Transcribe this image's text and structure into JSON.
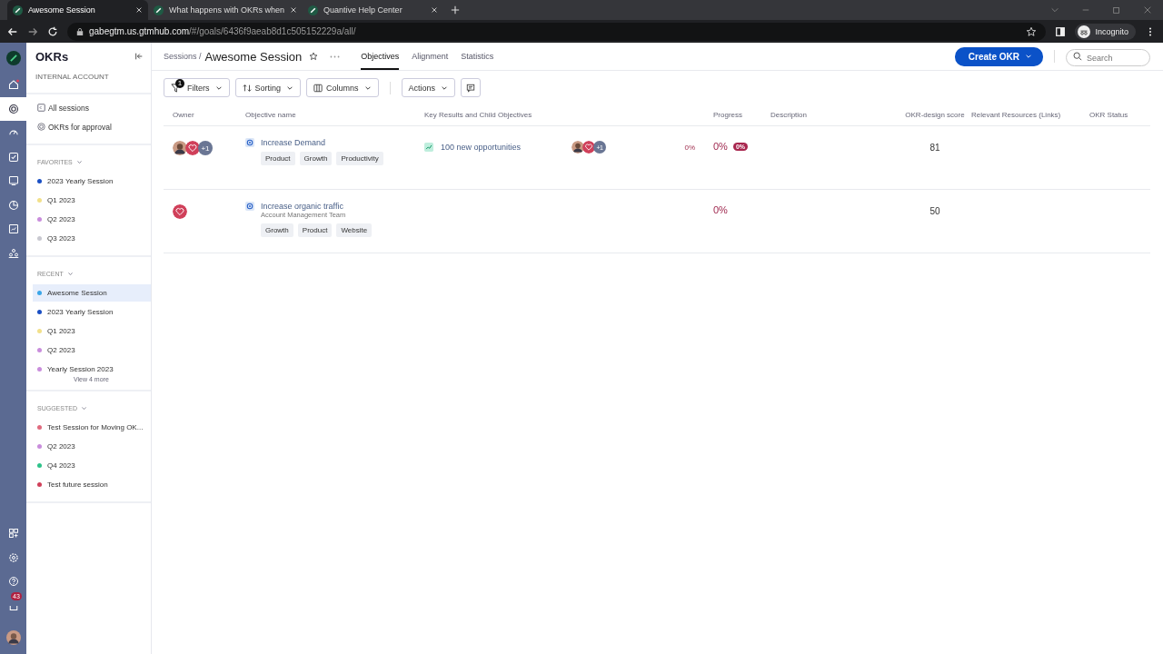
{
  "browser": {
    "tabs": [
      {
        "title": "Awesome Session",
        "selected": true
      },
      {
        "title": "What happens with OKRs when",
        "selected": false
      },
      {
        "title": "Quantive Help Center",
        "selected": false
      }
    ],
    "url": {
      "host": "gabegtm.us.gtmhub.com",
      "path": "/#/goals/6436f9aeab8d1c505152229a/all/"
    },
    "profile": "Incognito"
  },
  "rail": {
    "notification_count": "43"
  },
  "sidebar": {
    "title": "OKRs",
    "account": "INTERNAL ACCOUNT",
    "links": [
      {
        "label": "All sessions",
        "kind": "list"
      },
      {
        "label": "OKRs for approval",
        "kind": "approval"
      }
    ],
    "sections": [
      {
        "title": "FAVORITES",
        "items": [
          {
            "label": "2023 Yearly Session",
            "color": "#1a4fc4",
            "selected": false
          },
          {
            "label": "Q1 2023",
            "color": "#f2e08a",
            "selected": false
          },
          {
            "label": "Q2 2023",
            "color": "#c98ddc",
            "selected": false
          },
          {
            "label": "Q3 2023",
            "color": "#c8c8d0",
            "selected": false
          }
        ]
      },
      {
        "title": "RECENT",
        "items": [
          {
            "label": "Awesome Session",
            "color": "#3aa6e8",
            "selected": true
          },
          {
            "label": "2023 Yearly Session",
            "color": "#1a4fc4",
            "selected": false
          },
          {
            "label": "Q1 2023",
            "color": "#f2e08a",
            "selected": false
          },
          {
            "label": "Q2 2023",
            "color": "#c98ddc",
            "selected": false
          },
          {
            "label": "Yearly Session 2023",
            "color": "#c98ddc",
            "selected": false
          }
        ],
        "more": "View 4 more"
      },
      {
        "title": "SUGGESTED",
        "items": [
          {
            "label": "Test Session for Moving OK...",
            "color": "#e06a7e",
            "selected": false
          },
          {
            "label": "Q2 2023",
            "color": "#c98ddc",
            "selected": false
          },
          {
            "label": "Q4 2023",
            "color": "#2ec28a",
            "selected": false
          },
          {
            "label": "Test future session",
            "color": "#d0405a",
            "selected": false
          }
        ]
      }
    ]
  },
  "header": {
    "breadcrumb": "Sessions /",
    "title": "Awesome Session",
    "tabs": [
      {
        "label": "Objectives",
        "selected": true
      },
      {
        "label": "Alignment",
        "selected": false
      },
      {
        "label": "Statistics",
        "selected": false
      }
    ],
    "create_button": "Create OKR",
    "search": {
      "placeholder": "Search"
    }
  },
  "toolbar": {
    "filters": {
      "label": "Filters",
      "count": "1"
    },
    "sorting": "Sorting",
    "columns": "Columns",
    "actions": "Actions"
  },
  "table": {
    "columns": [
      "Owner",
      "Objective name",
      "Key Results and Child Objectives",
      "Progress",
      "Description",
      "OKR-design score",
      "Relevant Resources (Links)",
      "OKR Status"
    ],
    "rows": [
      {
        "owners": [
          {
            "kind": "person"
          },
          {
            "kind": "heart"
          },
          {
            "kind": "count",
            "text": "+1"
          }
        ],
        "name": "Increase Demand",
        "tags": [
          "Product",
          "Growth",
          "Productivity"
        ],
        "key_result": {
          "name": "100 new opportunities",
          "owners": [
            {
              "kind": "person"
            },
            {
              "kind": "heart"
            },
            {
              "kind": "count",
              "text": "+1"
            }
          ],
          "progress": "0%"
        },
        "progress": "0%",
        "progress_badge": "0%",
        "score": "81"
      },
      {
        "owners": [
          {
            "kind": "heart"
          }
        ],
        "name": "Increase organic traffic",
        "team": "Account Management Team",
        "tags": [
          "Growth",
          "Product",
          "Website"
        ],
        "progress": "0%",
        "score": "50"
      }
    ]
  }
}
